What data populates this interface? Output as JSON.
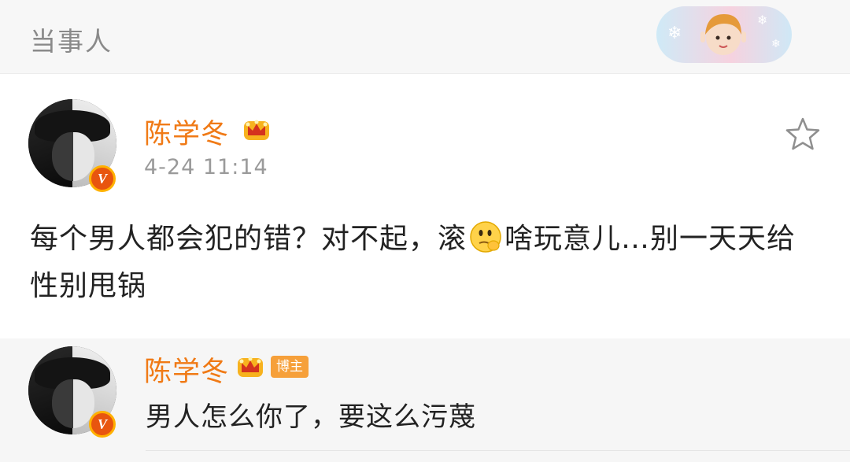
{
  "header": {
    "title": "当事人"
  },
  "post": {
    "username": "陈学冬",
    "timestamp": "4-24 11:14",
    "text_before_emoji": "每个男人都会犯的错？对不起，滚",
    "emoji": "thinking-emoji",
    "text_after_emoji": "啥玩意儿…别一天天给性别甩锅"
  },
  "comment": {
    "username": "陈学冬",
    "tag": "博主",
    "text": "男人怎么你了，要这么污蔑"
  },
  "colors": {
    "username": "#f07a16",
    "badge": "#e8550f",
    "tag": "#f6a03a",
    "timestamp": "#9a9a9a"
  },
  "icons": [
    "crown-icon",
    "verified-v-icon",
    "star-icon",
    "thinking-emoji"
  ]
}
